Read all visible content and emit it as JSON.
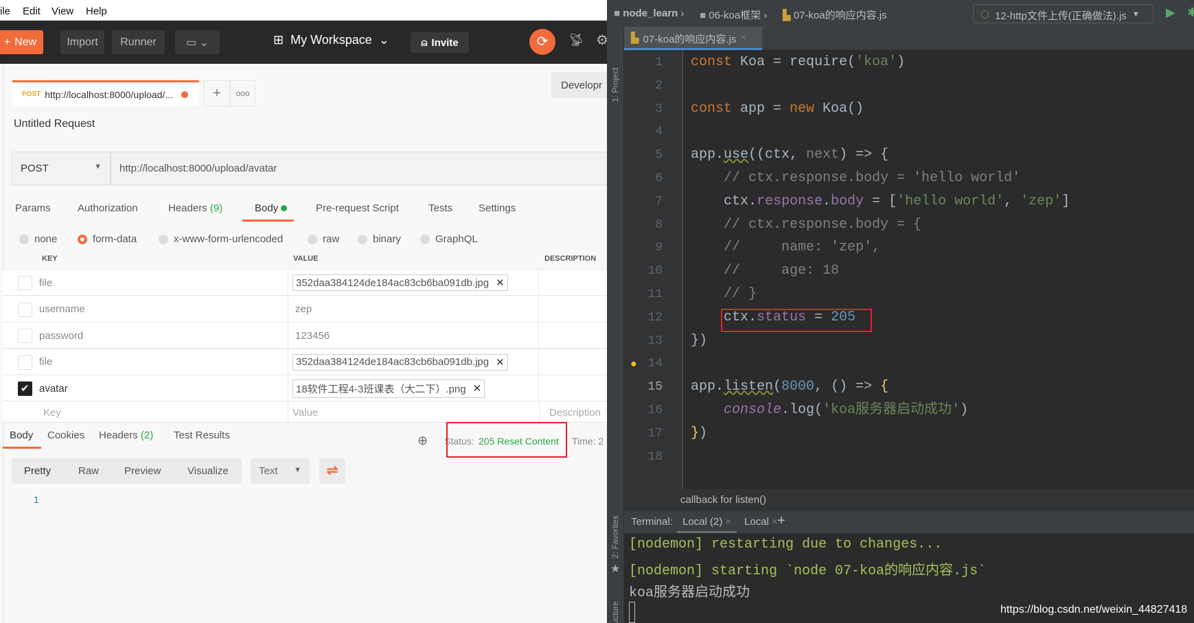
{
  "postman": {
    "menu": [
      "ile",
      "Edit",
      "View",
      "Help"
    ],
    "header": {
      "new": "New",
      "import": "Import",
      "runner": "Runner",
      "workspace": "My Workspace",
      "invite": "Invite"
    },
    "request_tab": {
      "method": "POST",
      "url": "http://localhost:8000/upload/..."
    },
    "environment": "Developr",
    "title": "Untitled Request",
    "method": "POST",
    "url": "http://localhost:8000/upload/avatar",
    "param_tabs": [
      {
        "label": "Params"
      },
      {
        "label": "Authorization"
      },
      {
        "label": "Headers",
        "count": "(9)"
      },
      {
        "label": "Body"
      },
      {
        "label": "Pre-request Script"
      },
      {
        "label": "Tests"
      },
      {
        "label": "Settings"
      }
    ],
    "body_types": [
      "none",
      "form-data",
      "x-www-form-urlencoded",
      "raw",
      "binary",
      "GraphQL"
    ],
    "selected_body_type": "form-data",
    "table_headers": [
      "KEY",
      "VALUE",
      "DESCRIPTION"
    ],
    "rows": [
      {
        "key": "file",
        "value": "352daa384124de184ac83cb6ba091db.jpg",
        "file": true,
        "checked": false
      },
      {
        "key": "username",
        "value": "zep",
        "file": false,
        "checked": false
      },
      {
        "key": "password",
        "value": "123456",
        "file": false,
        "checked": false
      },
      {
        "key": "file",
        "value": "352daa384124de184ac83cb6ba091db.jpg",
        "file": true,
        "checked": false
      },
      {
        "key": "avatar",
        "value": "18软件工程4-3班课表（大二下）.png",
        "file": true,
        "checked": true
      }
    ],
    "placeholder_row": {
      "key": "Key",
      "value": "Value",
      "description": "Description"
    },
    "response_tabs": [
      {
        "label": "Body"
      },
      {
        "label": "Cookies"
      },
      {
        "label": "Headers",
        "count": "(2)"
      },
      {
        "label": "Test Results"
      }
    ],
    "status_label": "Status:",
    "status_value": "205 Reset Content",
    "time_label": "Time: 2",
    "view_modes": [
      "Pretty",
      "Raw",
      "Preview",
      "Visualize"
    ],
    "format": "Text",
    "response_line": "1",
    "colors": {
      "accent": "#f26b3a",
      "status": "#28a745",
      "highlight_box": "#e8202a"
    }
  },
  "ide": {
    "breadcrumb": [
      "node_learn",
      "06-koa框架",
      "07-koa的响应内容.js"
    ],
    "run_config": "12-http文件上传(正确做法).js",
    "file_tab": "07-koa的响应内容.js",
    "side_tools": [
      "1: Project",
      "2: Favorites",
      "Z: Structure"
    ],
    "code_lines": [
      [
        [
          "const ",
          "kw"
        ],
        [
          "Koa = require(",
          ""
        ],
        [
          "'koa'",
          "str"
        ],
        [
          ")",
          ""
        ]
      ],
      [],
      [
        [
          "const ",
          "kw"
        ],
        [
          "app = ",
          ""
        ],
        [
          "new ",
          "kw"
        ],
        [
          "Koa()",
          ""
        ]
      ],
      [],
      [
        [
          "app.",
          ""
        ],
        [
          "use",
          "wv"
        ],
        [
          "((ctx, ",
          ""
        ],
        [
          "next",
          "cm"
        ],
        [
          ") => {",
          ""
        ]
      ],
      [
        [
          "    // ctx.response.body = 'hello world'",
          "cm"
        ]
      ],
      [
        [
          "    ctx.",
          ""
        ],
        [
          "response",
          "prop"
        ],
        [
          ".",
          ""
        ],
        [
          "body",
          "prop"
        ],
        [
          " = [",
          ""
        ],
        [
          "'hello world'",
          "str"
        ],
        [
          ", ",
          ""
        ],
        [
          "'zep'",
          "str"
        ],
        [
          "]",
          ""
        ]
      ],
      [
        [
          "    // ctx.response.body = {",
          "cm"
        ]
      ],
      [
        [
          "    //     name: 'zep',",
          "cm"
        ]
      ],
      [
        [
          "    //     age: 18",
          "cm"
        ]
      ],
      [
        [
          "    // }",
          "cm"
        ]
      ],
      [
        [
          "    ctx.",
          ""
        ],
        [
          "status",
          "prop"
        ],
        [
          " = ",
          ""
        ],
        [
          "205",
          "num"
        ]
      ],
      [
        [
          "})",
          ""
        ]
      ],
      [],
      [
        [
          "app.",
          ""
        ],
        [
          "listen",
          "wv"
        ],
        [
          "(",
          ""
        ],
        [
          "8000",
          "num"
        ],
        [
          ", () => ",
          ""
        ],
        [
          "{",
          "fn"
        ]
      ],
      [
        [
          "    ",
          ""
        ],
        [
          "console",
          "it"
        ],
        [
          ".log(",
          ""
        ],
        [
          "'koa服务器启动成功'",
          "str"
        ],
        [
          ")",
          ""
        ]
      ],
      [
        [
          "}",
          "fn"
        ],
        [
          ")",
          ""
        ]
      ],
      []
    ],
    "hint": "callback for listen()",
    "terminal": {
      "label": "Terminal:",
      "tabs": [
        "Local (2)",
        "Local"
      ],
      "lines": [
        {
          "text": "[nodemon] restarting due to changes...",
          "color": "#a5c25c"
        },
        {
          "text": "[nodemon] starting `node 07-koa的响应内容.js`",
          "color": "#a5c25c"
        },
        {
          "text": "koa服务器启动成功",
          "color": "#bbbbbb"
        }
      ]
    },
    "watermark": "https://blog.csdn.net/weixin_44827418"
  }
}
